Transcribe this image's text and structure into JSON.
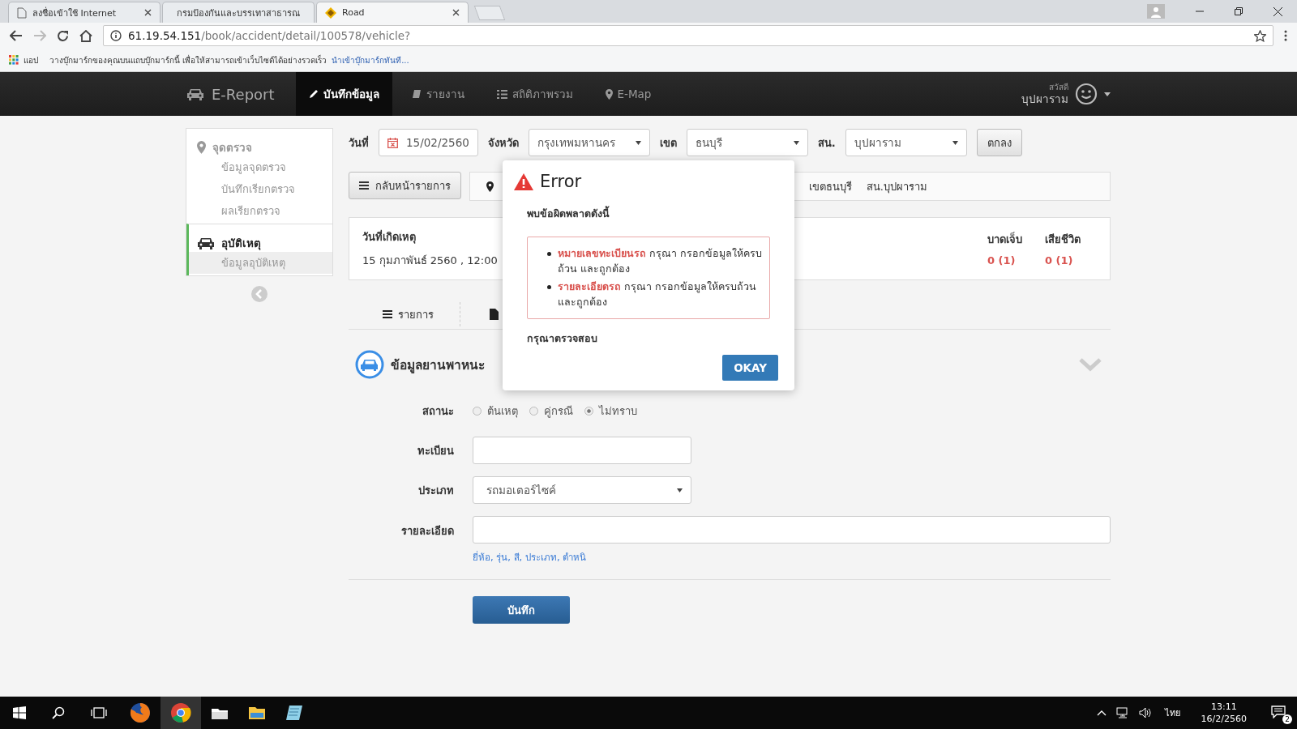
{
  "browser": {
    "tabs": [
      {
        "title": "ลงชื่อเข้าใช้ Internet",
        "selected": false
      },
      {
        "title": "กรมป้องกันและบรรเทาสาธารณ",
        "selected": false
      },
      {
        "title": "Road",
        "selected": true
      }
    ],
    "url_host": "61.19.54.151",
    "url_path": "/book/accident/detail/100578/vehicle?",
    "bookmarks_apps": "แอป",
    "bookmarks_hint": "วางบุ๊กมาร์กของคุณบนแถบบุ๊กมาร์กนี้ เพื่อให้สามารถเข้าเว็บไซต์ได้อย่างรวดเร็ว",
    "bookmarks_link": "นำเข้าบุ๊กมาร์กทันที..."
  },
  "nav": {
    "brand": "E-Report",
    "items": [
      {
        "label": "บันทึกข้อมูล",
        "selected": true
      },
      {
        "label": "รายงาน",
        "selected": false
      },
      {
        "label": "สถิติภาพรวม",
        "selected": false
      },
      {
        "label": "E-Map",
        "selected": false
      }
    ],
    "greeting": "สวัสดี",
    "user": "บุปผาราม"
  },
  "sidebar": {
    "groups": [
      {
        "title": "จุดตรวจ",
        "active": false,
        "items": [
          {
            "label": "ข้อมูลจุดตรวจ",
            "selected": false
          },
          {
            "label": "บันทึกเรียกตรวจ",
            "selected": false
          },
          {
            "label": "ผลเรียกตรวจ",
            "selected": false
          }
        ]
      },
      {
        "title": "อุบัติเหตุ",
        "active": true,
        "items": [
          {
            "label": "ข้อมูลอุบัติเหตุ",
            "selected": true
          }
        ]
      }
    ]
  },
  "filters": [
    {
      "label": "วันที่",
      "kind": "date",
      "value": "15/02/2560"
    },
    {
      "label": "จังหวัด",
      "kind": "select",
      "value": "กรุงเทพมหานคร"
    },
    {
      "label": "เขต",
      "kind": "select",
      "value": "ธนบุรี"
    },
    {
      "label": "สน.",
      "kind": "select",
      "value": "บุปผาราม"
    }
  ],
  "filter_submit": "ตกลง",
  "breadcrumb": {
    "back": "กลับหน้ารายการ",
    "items": [
      "เขตธนบุรี",
      "สน.บุปผาราม"
    ]
  },
  "summary": {
    "date_label": "วันที่เกิดเหตุ",
    "date_value": "15 กุมภาพันธ์ 2560 , 12:00",
    "stats": [
      {
        "label": "บาดเจ็บ",
        "value": "0 (1)"
      },
      {
        "label": "เสียชีวิต",
        "value": "0 (1)"
      }
    ]
  },
  "subtabs": [
    {
      "label": "รายการ"
    }
  ],
  "section": {
    "title": "ข้อมูลยานพาหนะ"
  },
  "form": {
    "status_label": "สถานะ",
    "status_options": [
      {
        "label": "ต้นเหตุ",
        "selected": false
      },
      {
        "label": "คู่กรณี",
        "selected": false
      },
      {
        "label": "ไม่ทราบ",
        "selected": true
      }
    ],
    "plate_label": "ทะเบียน",
    "type_label": "ประเภท",
    "type_value": "รถมอเตอร์ไซค์",
    "detail_label": "รายละเอียด",
    "detail_help": "ยี่ห้อ, รุ่น, สี, ประเภท, ตำหนิ",
    "save": "บันทึก"
  },
  "modal": {
    "title": "Error",
    "intro": "พบข้อผิดพลาดดังนี้",
    "errors": [
      {
        "field": "หมายเลขทะเบียนรถ",
        "message": "กรุณา กรอกข้อมูลให้ครบถ้วน และถูกต้อง"
      },
      {
        "field": "รายละเอียดรถ",
        "message": "กรุณา กรอกข้อมูลให้ครบถ้วน และถูกต้อง"
      }
    ],
    "footer": "กรุณาตรวจสอบ",
    "button": "OKAY"
  },
  "taskbar": {
    "language": "ไทย",
    "time": "13:11",
    "date": "16/2/2560",
    "notifications": "2"
  }
}
